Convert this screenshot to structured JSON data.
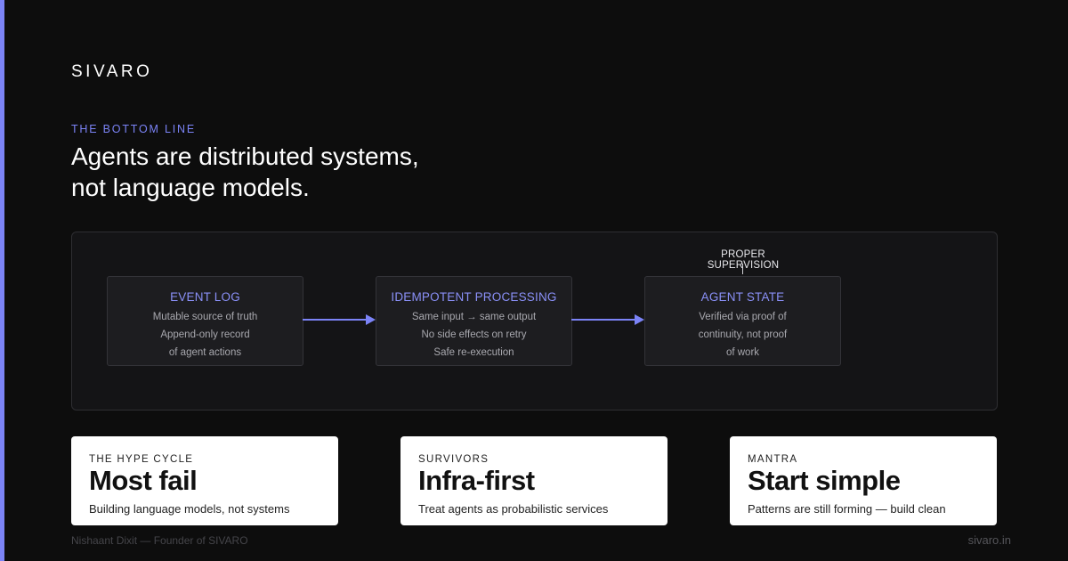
{
  "brand": {
    "logo": "SIVARO",
    "accent_color": "#7b83f6"
  },
  "header": {
    "eyebrow": "THE BOTTOM LINE",
    "headline_line1": "Agents are distributed systems,",
    "headline_line2": "not language models."
  },
  "diagram": {
    "supervision_label": "PROPER SUPERVISION",
    "nodes": [
      {
        "title": "EVENT LOG",
        "lines": [
          "Mutable source of truth",
          "Append-only record",
          "of agent actions"
        ]
      },
      {
        "title": "IDEMPOTENT PROCESSING",
        "lines": [
          "Same input → same output",
          "No side effects on retry",
          "Safe re-execution"
        ]
      },
      {
        "title": "AGENT STATE",
        "lines": [
          "Verified via proof of",
          "continuity, not proof",
          "of work"
        ]
      }
    ],
    "edges": [
      {
        "from": "EVENT LOG",
        "to": "IDEMPOTENT PROCESSING"
      },
      {
        "from": "IDEMPOTENT PROCESSING",
        "to": "AGENT STATE"
      }
    ]
  },
  "cards": [
    {
      "eyebrow": "THE HYPE CYCLE",
      "title": "Most fail",
      "caption": "Building language models, not systems"
    },
    {
      "eyebrow": "SURVIVORS",
      "title": "Infra-first",
      "caption": "Treat agents as probabilistic services"
    },
    {
      "eyebrow": "MANTRA",
      "title": "Start simple",
      "caption": "Patterns are still forming — build clean"
    }
  ],
  "footer": {
    "author": "Nishaant Dixit — Founder of SIVARO",
    "site": "sivaro.in"
  }
}
